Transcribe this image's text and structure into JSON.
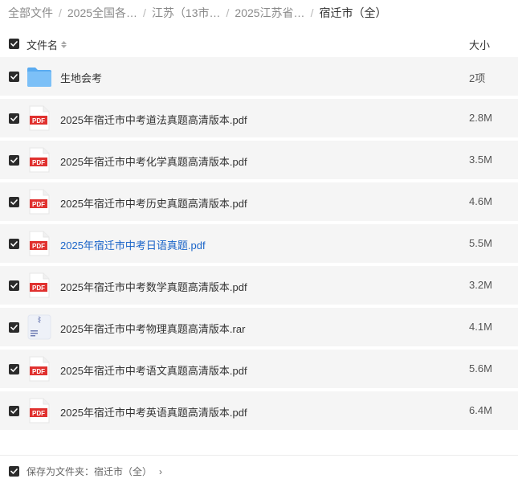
{
  "breadcrumb": {
    "items": [
      "全部文件",
      "2025全国各…",
      "江苏（13市…",
      "2025江苏省…"
    ],
    "current": "宿迁市（全）",
    "separator": "/"
  },
  "header": {
    "name_label": "文件名",
    "size_label": "大小"
  },
  "files": [
    {
      "name": "生地会考",
      "size": "2项",
      "type": "folder-icon",
      "selected": true
    },
    {
      "name": "2025年宿迁市中考道法真题高清版本.pdf",
      "size": "2.8M",
      "type": "pdf-icon",
      "selected": true
    },
    {
      "name": "2025年宿迁市中考化学真题高清版本.pdf",
      "size": "3.5M",
      "type": "pdf-icon",
      "selected": true
    },
    {
      "name": "2025年宿迁市中考历史真题高清版本.pdf",
      "size": "4.6M",
      "type": "pdf-icon",
      "selected": true
    },
    {
      "name": "2025年宿迁市中考日语真题.pdf",
      "size": "5.5M",
      "type": "pdf-icon",
      "selected": true
    },
    {
      "name": "2025年宿迁市中考数学真题高清版本.pdf",
      "size": "3.2M",
      "type": "pdf-icon",
      "selected": true
    },
    {
      "name": "2025年宿迁市中考物理真题高清版本.rar",
      "size": "4.1M",
      "type": "archive-icon",
      "selected": true
    },
    {
      "name": "2025年宿迁市中考语文真题高清版本.pdf",
      "size": "5.6M",
      "type": "pdf-icon",
      "selected": true
    },
    {
      "name": "2025年宿迁市中考英语真题高清版本.pdf",
      "size": "6.4M",
      "type": "pdf-icon",
      "selected": true
    }
  ],
  "pdf_badge": "PDF",
  "footer": {
    "save_label": "保存为文件夹：宿迁市（全）",
    "chevron": "›"
  },
  "colors": {
    "row_bg": "#f5f5f5",
    "link": "#1a64c8",
    "pdf_red": "#e0312f",
    "folder_blue": "#5aabf0"
  }
}
